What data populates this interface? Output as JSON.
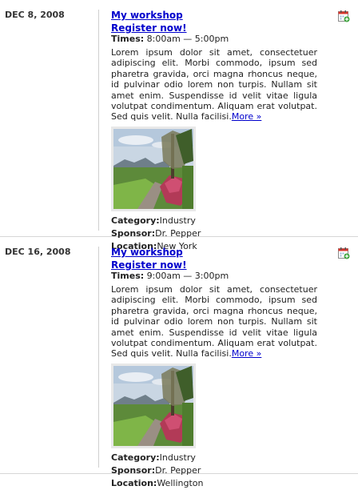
{
  "events": [
    {
      "date": "DEC 8, 2008",
      "title": "My workshop",
      "register": "Register now!",
      "times_label": "Times:",
      "times_value": " 8:00am — 5:00pm",
      "description": "Lorem ipsum dolor sit amet, consectetuer adipiscing elit. Morbi commodo, ipsum sed pharetra gravida, orci magna rhoncus neque, id pulvinar odio lorem non turpis. Nullam sit amet enim. Suspendisse id velit vitae ligula volutpat condimentum. Aliquam erat volutpat. Sed quis velit. Nulla facilisi.",
      "more": "More »",
      "category_label": "Category:",
      "category": "Industry",
      "sponsor_label": "Sponsor:",
      "sponsor": "Dr. Pepper",
      "location_label": "Location:",
      "location": "New York",
      "icon": "calendar-add-icon"
    },
    {
      "date": "DEC 16, 2008",
      "title": "My workshop",
      "register": "Register now!",
      "times_label": "Times:",
      "times_value": " 9:00am — 3:00pm",
      "description": "Lorem ipsum dolor sit amet, consectetuer adipiscing elit. Morbi commodo, ipsum sed pharetra gravida, orci magna rhoncus neque, id pulvinar odio lorem non turpis. Nullam sit amet enim. Suspendisse id velit vitae ligula volutpat condimentum. Aliquam erat volutpat. Sed quis velit. Nulla facilisi.",
      "more": "More »",
      "category_label": "Category:",
      "category": "Industry",
      "sponsor_label": "Sponsor:",
      "sponsor": "Dr. Pepper",
      "location_label": "Location:",
      "location": "Wellington",
      "icon": "calendar-add-icon"
    }
  ],
  "colors": {
    "link": "#0000cc",
    "divider": "#cfcfcf",
    "separator": "#d6d6d6"
  }
}
